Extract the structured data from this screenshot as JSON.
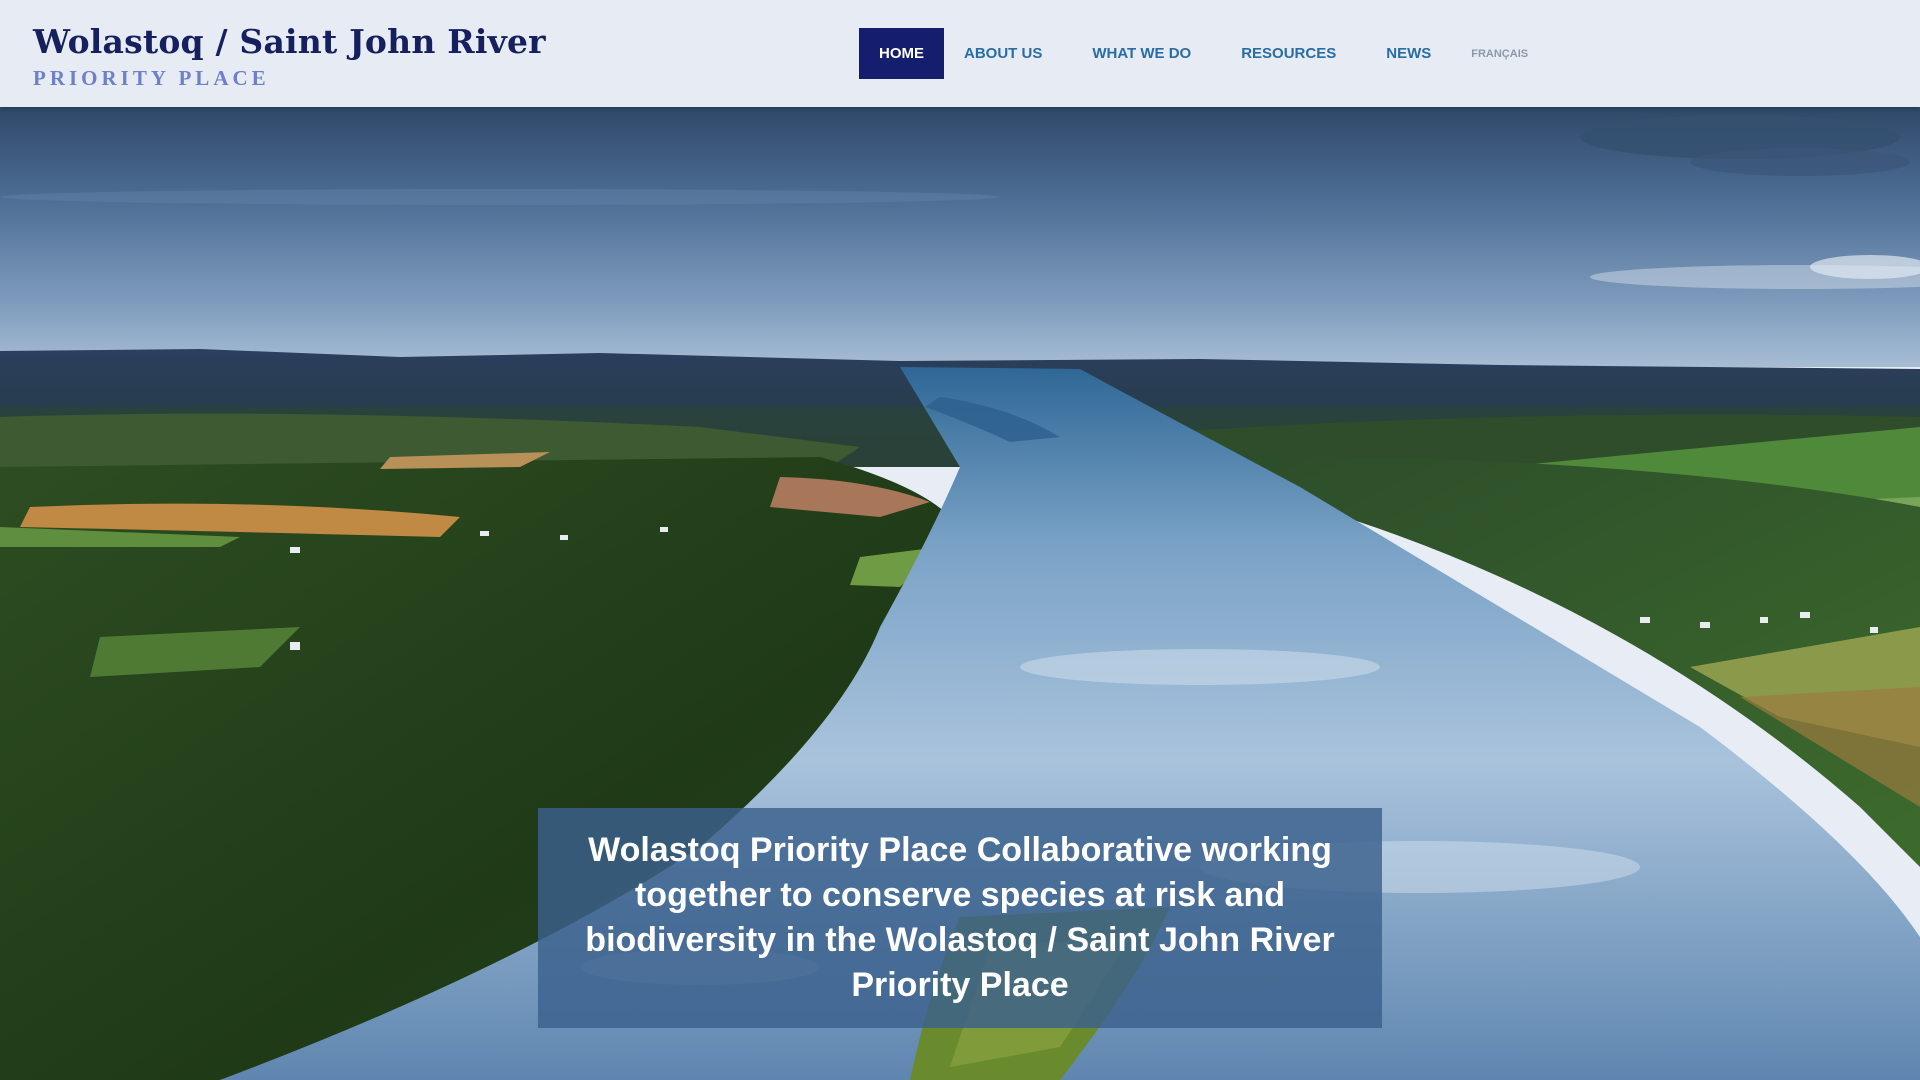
{
  "site": {
    "title": "Wolastoq / Saint John River",
    "subtitle": "PRIORITY PLACE"
  },
  "nav": {
    "items": [
      {
        "label": "HOME",
        "active": true
      },
      {
        "label": "ABOUT US",
        "active": false
      },
      {
        "label": "WHAT WE DO",
        "active": false
      },
      {
        "label": "RESOURCES",
        "active": false
      },
      {
        "label": "NEWS",
        "active": false
      }
    ],
    "language": "FRANÇAIS"
  },
  "hero": {
    "image": "aerial-river-valley-photo",
    "banner_text": "Wolastoq Priority Place Collaborative working together to conserve species at risk and biodiversity in the Wolastoq / Saint John River Priority Place"
  },
  "colors": {
    "brand_navy": "#16205e",
    "brand_accent": "#6f7fca",
    "nav_link": "#2a6ca4",
    "nav_active_bg": "#141d6e",
    "banner_bg": "#3a608c"
  }
}
